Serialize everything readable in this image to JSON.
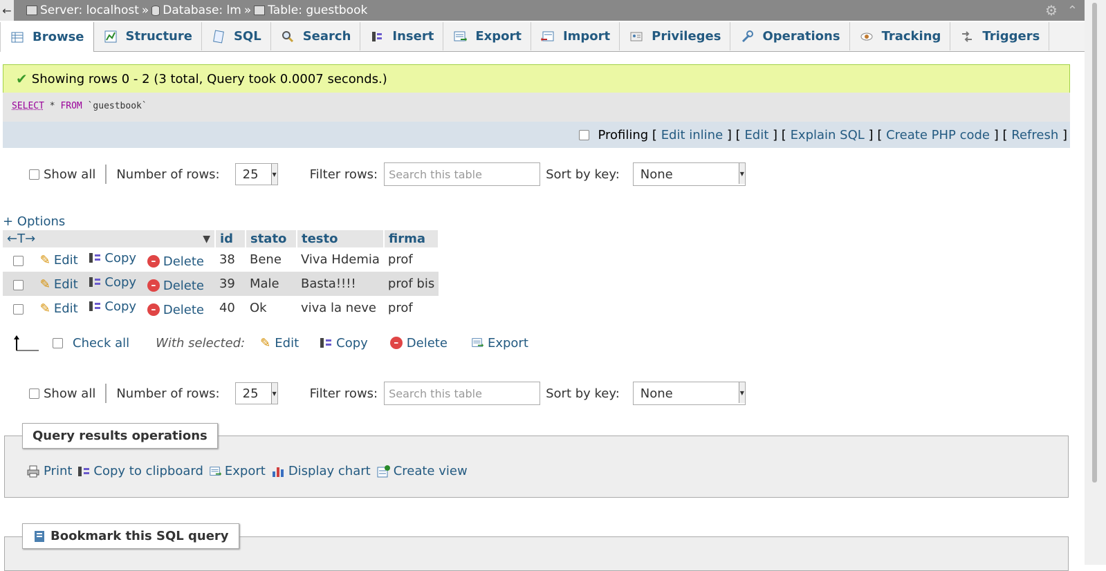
{
  "breadcrumb": {
    "back": "←",
    "server": "Server: localhost",
    "database": "Database: lm",
    "table": "Table: guestbook",
    "sep": "»"
  },
  "tabs": [
    {
      "label": "Browse",
      "icon": "browse-icon"
    },
    {
      "label": "Structure",
      "icon": "structure-icon"
    },
    {
      "label": "SQL",
      "icon": "sql-icon"
    },
    {
      "label": "Search",
      "icon": "search-icon"
    },
    {
      "label": "Insert",
      "icon": "insert-icon"
    },
    {
      "label": "Export",
      "icon": "export-icon"
    },
    {
      "label": "Import",
      "icon": "import-icon"
    },
    {
      "label": "Privileges",
      "icon": "privileges-icon"
    },
    {
      "label": "Operations",
      "icon": "operations-icon"
    },
    {
      "label": "Tracking",
      "icon": "tracking-icon"
    },
    {
      "label": "Triggers",
      "icon": "triggers-icon"
    }
  ],
  "message": "Showing rows 0 - 2 (3 total, Query took 0.0007 seconds.)",
  "sql": {
    "select": "SELECT",
    "star": "*",
    "from": "FROM",
    "table": "`guestbook`"
  },
  "sqlbar": {
    "profiling": "Profiling",
    "edit_inline": "Edit inline",
    "edit": "Edit",
    "explain": "Explain SQL",
    "php": "Create PHP code",
    "refresh": "Refresh",
    "open": "[",
    "close": "]"
  },
  "nav": {
    "show_all": "Show all",
    "rows_label": "Number of rows:",
    "rows_value": "25",
    "filter_label": "Filter rows:",
    "filter_placeholder": "Search this table",
    "sort_label": "Sort by key:",
    "sort_value": "None"
  },
  "options": "+ Options",
  "columns": {
    "resize": "←T→",
    "c1": "id",
    "c2": "stato",
    "c3": "testo",
    "c4": "firma"
  },
  "row_actions": {
    "edit": "Edit",
    "copy": "Copy",
    "delete": "Delete"
  },
  "rows": [
    {
      "id": "38",
      "stato": "Bene",
      "testo": "Viva Hdemia",
      "firma": "prof"
    },
    {
      "id": "39",
      "stato": "Male",
      "testo": "Basta!!!!",
      "firma": "prof bis"
    },
    {
      "id": "40",
      "stato": "Ok",
      "testo": "viva la neve",
      "firma": "prof"
    }
  ],
  "with_selected": {
    "check_all": "Check all",
    "label": "With selected:",
    "edit": "Edit",
    "copy": "Copy",
    "delete": "Delete",
    "export": "Export"
  },
  "ops": {
    "title": "Query results operations",
    "print": "Print",
    "clipboard": "Copy to clipboard",
    "export": "Export",
    "chart": "Display chart",
    "view": "Create view"
  },
  "bookmark": {
    "title": "Bookmark this SQL query"
  }
}
